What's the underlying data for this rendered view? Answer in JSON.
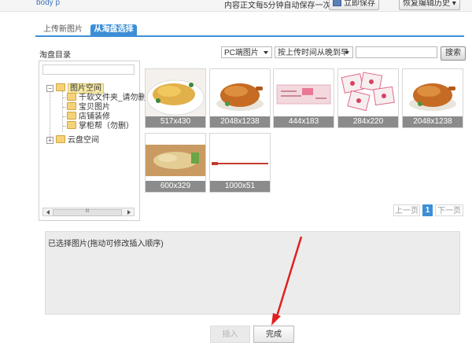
{
  "topbar": {
    "path": "body  p",
    "autosave_text": "内容正文每5分钟自动保存一次。",
    "save_now_label": "立即保存",
    "restore_label": "恢复编辑历史 ▾"
  },
  "tabs": [
    {
      "label": "上传新图片",
      "active": false
    },
    {
      "label": "从淘盘选择",
      "active": true
    }
  ],
  "toolbar": {
    "directory_label": "淘盘目录",
    "type_select": "PC端图片",
    "sort_select": "按上传时间从晚到早",
    "search_value": "",
    "search_label": "搜索"
  },
  "tree": {
    "root1": "图片空间",
    "children": [
      "千软文件夹_请勿删",
      "宝贝图片",
      "店铺装修",
      "掌柜帮（勿删）"
    ],
    "root2": "云盘空间",
    "scroll_glyph": "III"
  },
  "images": [
    {
      "size": "517x430",
      "kind": "chicken-plate"
    },
    {
      "size": "2048x1238",
      "kind": "roast-chicken"
    },
    {
      "size": "444x183",
      "kind": "pink-label"
    },
    {
      "size": "284x220",
      "kind": "packets"
    },
    {
      "size": "2048x1238",
      "kind": "roast-chicken"
    },
    {
      "size": "600x329",
      "kind": "chicken-board"
    },
    {
      "size": "1000x51",
      "kind": "red-line"
    }
  ],
  "pager": {
    "prev": "上一页",
    "current": "1",
    "next": "下一页"
  },
  "selected": {
    "hint": "已选择图片(拖动可修改插入顺序)"
  },
  "buttons": {
    "insert": "插入",
    "done": "完成"
  },
  "colors": {
    "accent": "#3c8fd6",
    "annotation_arrow": "#e02020"
  }
}
